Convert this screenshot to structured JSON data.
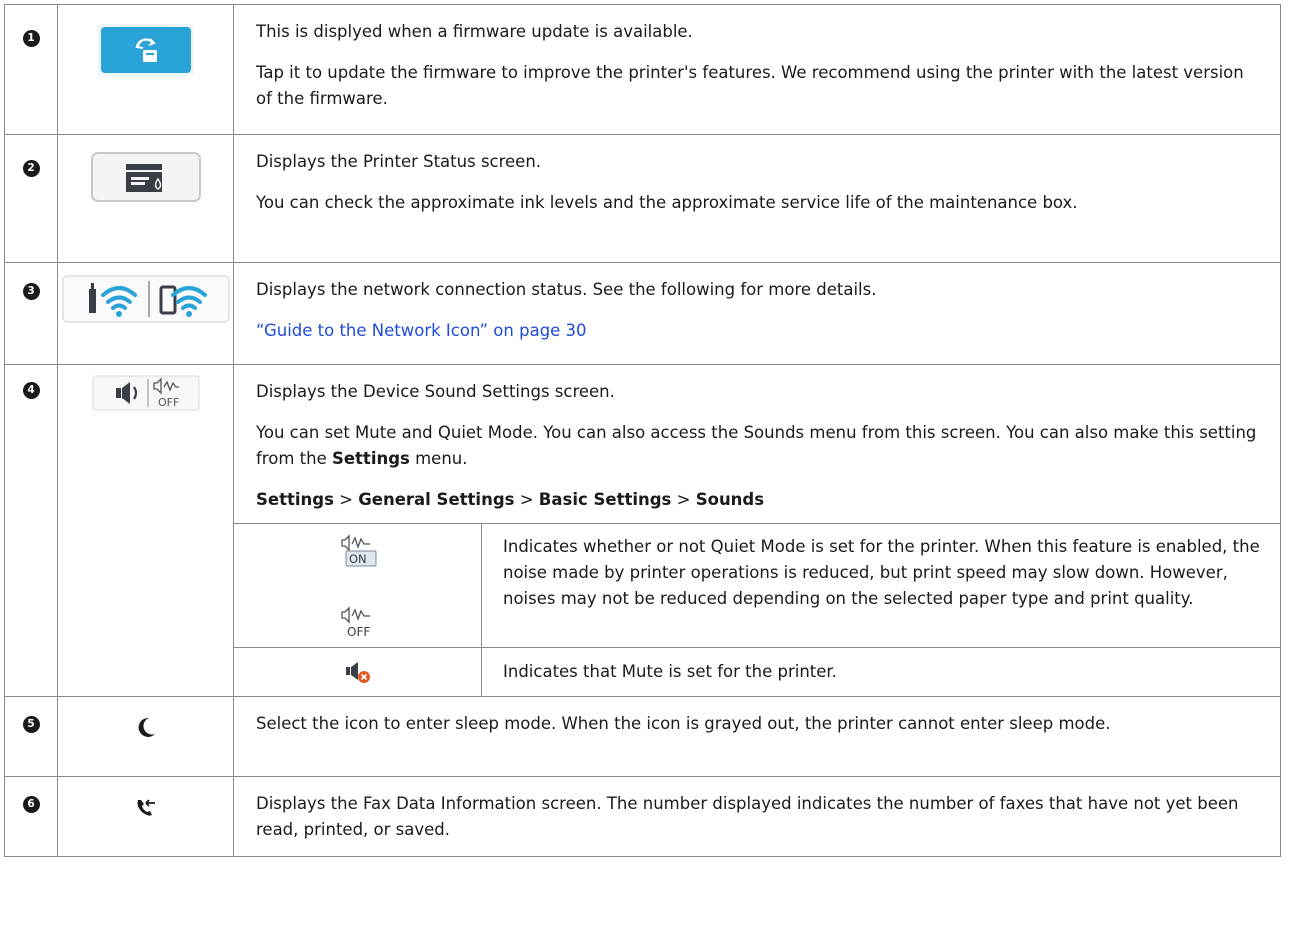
{
  "rows": [
    {
      "number": "1",
      "icon": "firmware-update-icon",
      "lines": [
        "This is displyed when a firmware update is available.",
        "Tap it to update the firmware to improve the printer's features. We recommend using the printer with the latest version of the firmware."
      ]
    },
    {
      "number": "2",
      "icon": "printer-status-icon",
      "lines": [
        "Displays the Printer Status screen.",
        "You can check the approximate ink levels and the approximate service life of the maintenance box."
      ]
    },
    {
      "number": "3",
      "icon": "network-status-icon",
      "lines": [
        "Displays the network connection status. See the following for more details."
      ],
      "link": "“Guide to the Network Icon” on page 30"
    },
    {
      "number": "4",
      "icon": "device-sound-icon",
      "line1": "Displays the Device Sound Settings screen.",
      "line2_pre": "You can set Mute and Quiet Mode. You can also access the Sounds menu from this screen. You can also make this setting from the ",
      "line2_bold": "Settings",
      "line2_post": " menu.",
      "path": {
        "p1": "Settings",
        "sep1": " > ",
        "p2": "General Settings",
        "sep2": " > ",
        "p3": "Basic Settings",
        "sep3": " > ",
        "p4": "Sounds"
      },
      "sub": [
        {
          "icons": [
            "quiet-mode-on-icon",
            "quiet-mode-off-icon"
          ],
          "on_label": "ON",
          "off_label": "OFF",
          "text": "Indicates whether or not Quiet Mode is set for the printer. When this feature is enabled, the noise made by printer operations is reduced, but print speed may slow down. However, noises may not be reduced depending on the selected paper type and print quality."
        },
        {
          "icons": [
            "mute-icon"
          ],
          "text": "Indicates that Mute is set for the printer."
        }
      ]
    },
    {
      "number": "5",
      "icon": "sleep-moon-icon",
      "lines": [
        "Select the icon to enter sleep mode. When the icon is grayed out, the printer cannot enter sleep mode."
      ]
    },
    {
      "number": "6",
      "icon": "fax-data-icon",
      "lines": [
        "Displays the Fax Data Information screen. The number displayed indicates the number of faxes that have not yet been read, printed, or saved."
      ]
    }
  ],
  "colors": {
    "accent": "#2aa4d8",
    "link": "#1f4bd8",
    "mute_badge": "#e05a1e"
  }
}
